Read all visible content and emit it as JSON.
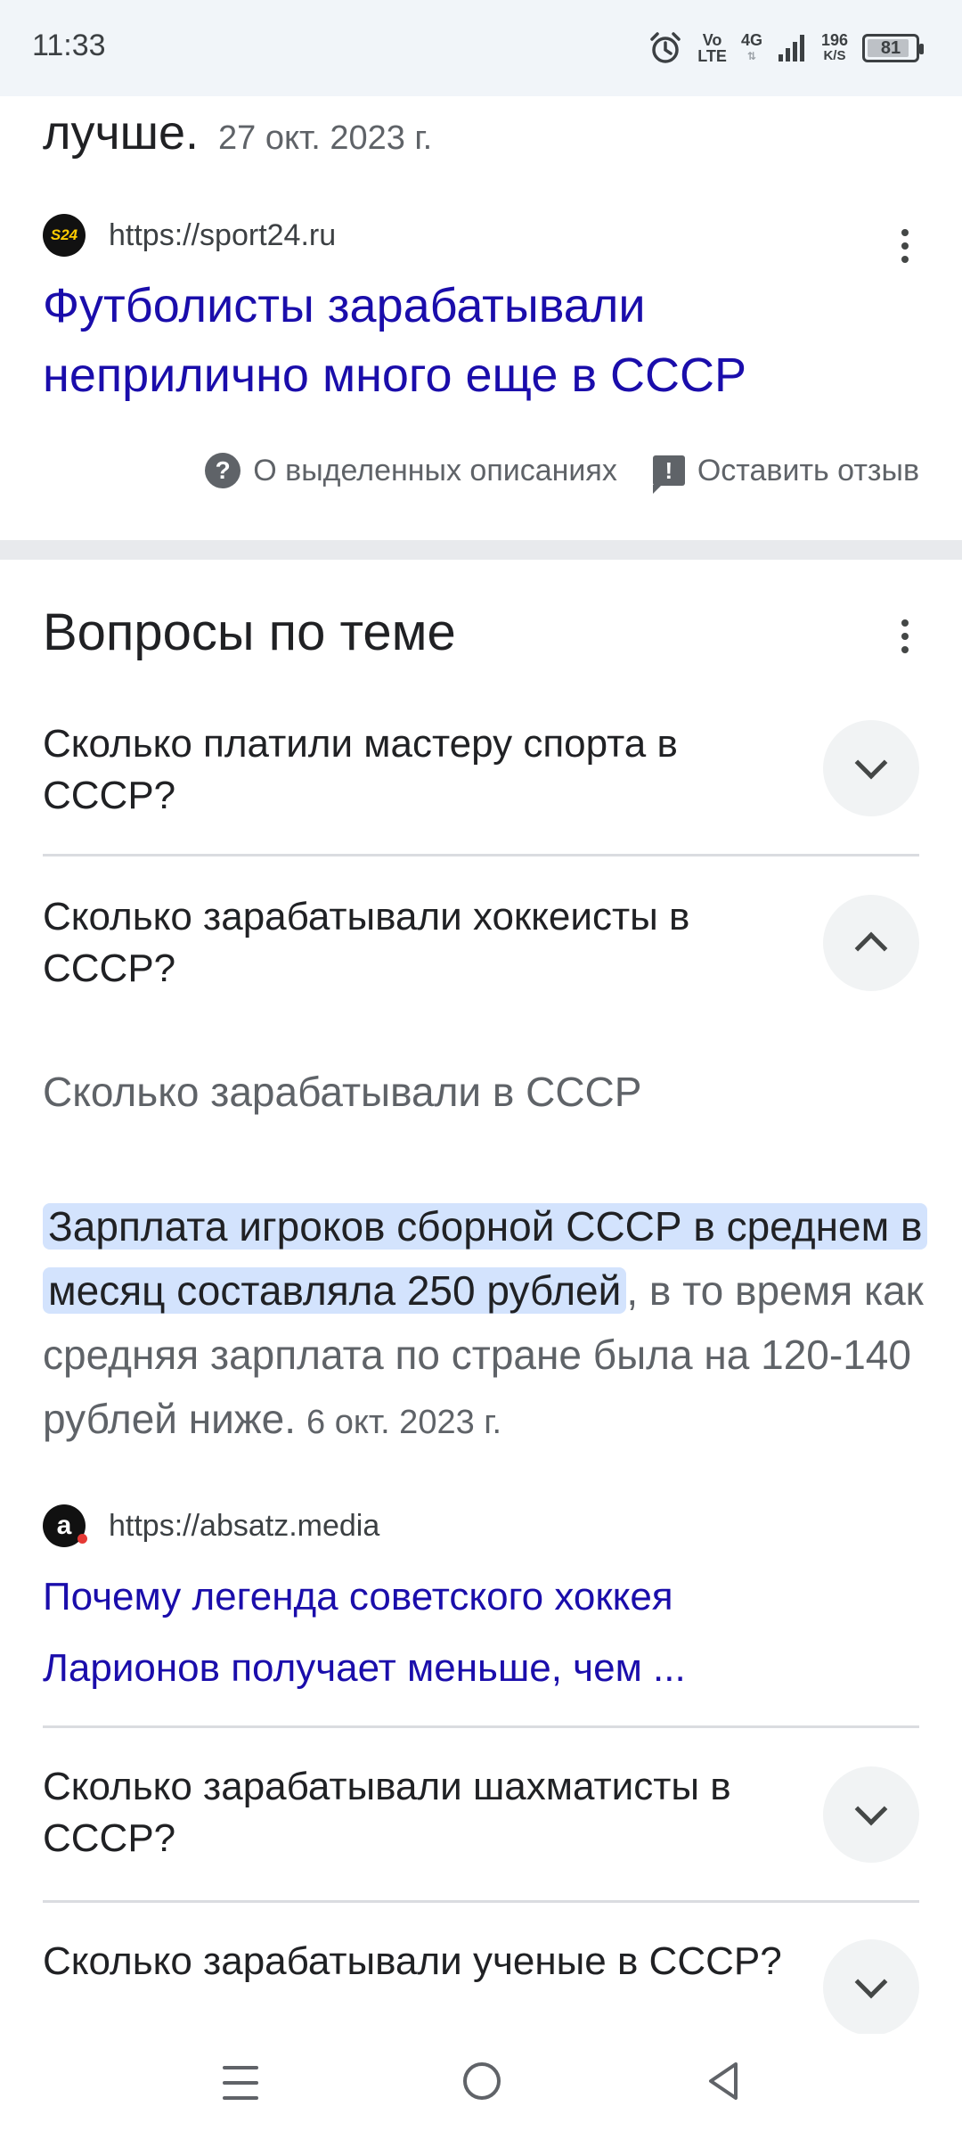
{
  "status_bar": {
    "time": "11:33",
    "volte": [
      "Vo",
      "LTE"
    ],
    "network": "4G",
    "net_speed": [
      "196",
      "K/S"
    ],
    "battery": "81",
    "battery_level_percent": 81
  },
  "top_result": {
    "tail_text": "лучше.",
    "date": "27 окт. 2023 г.",
    "favicon_text": "S24",
    "url": "https://sport24.ru",
    "title": "Футболисты зарабатывали неприлично много еще в СССР",
    "feedback_about": "О выделенных описаниях",
    "feedback_leave": "Оставить отзыв"
  },
  "paa": {
    "title": "Вопросы по теме",
    "questions": [
      {
        "text": "Сколько платили мастеру спорта в СССР?",
        "expanded": false
      },
      {
        "text": "Сколько зарабатывали хоккеисты в СССР?",
        "expanded": true
      },
      {
        "text": "Сколько зарабатывали шахматисты в СССР?",
        "expanded": false
      },
      {
        "text": "Сколько зарабатывали ученые в СССР?",
        "expanded": false
      }
    ],
    "answer": {
      "heading": "Сколько зарабатывали в СССР",
      "highlight": "Зарплата игроков сборной СССР в среднем в месяц составляла 250 рублей",
      "rest": ", в то время как средняя зарплата по стране была на 120-140 рублей ниже.",
      "date": "6 окт. 2023 г.",
      "favicon_text": "a",
      "url": "https://absatz.media",
      "link_title": "Почему легенда советского хоккея Ларионов получает меньше, чем ..."
    }
  },
  "icons": {
    "status": [
      "alarm-icon",
      "signal-icon",
      "battery-icon"
    ],
    "nav": [
      "menu-icon",
      "home-icon",
      "back-icon"
    ]
  }
}
